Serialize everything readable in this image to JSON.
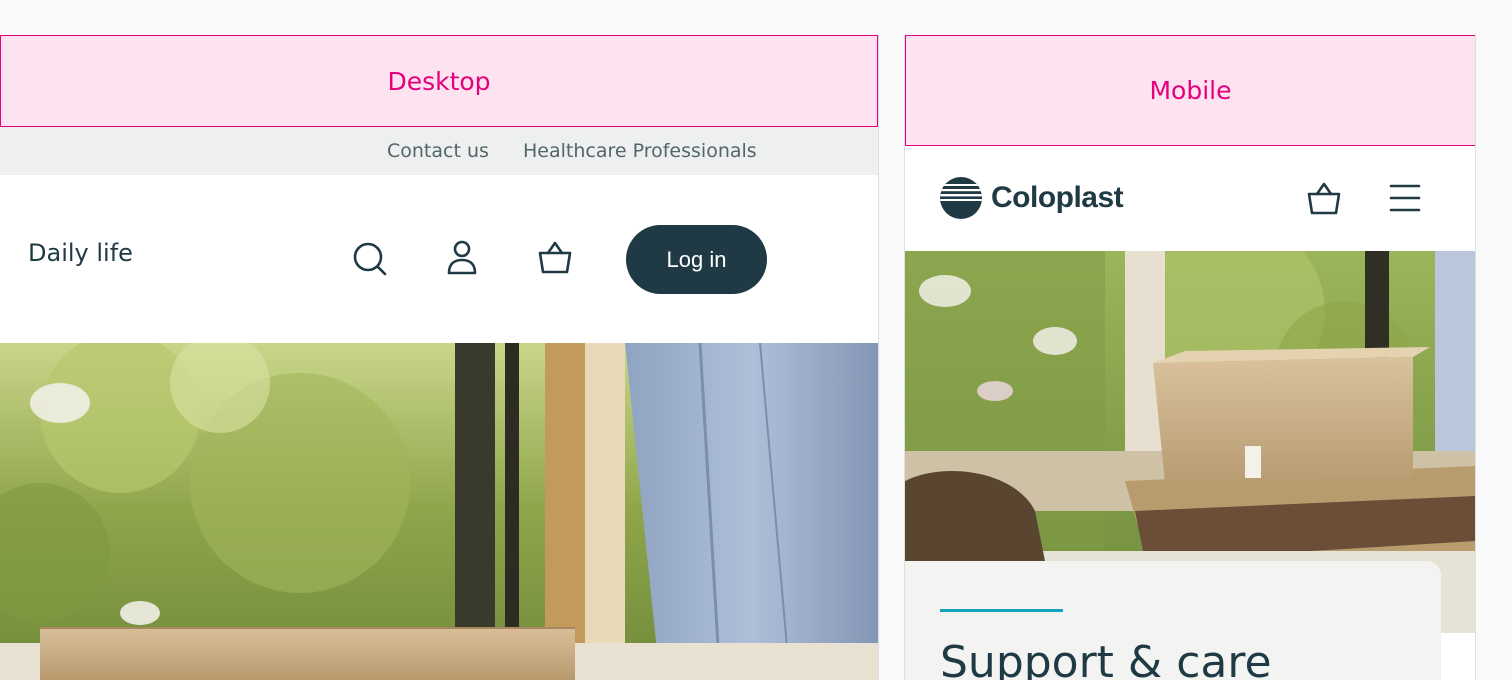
{
  "desktop": {
    "label": "Desktop",
    "utility_links": {
      "contact": "Contact us",
      "hcp": "Healthcare Professionals"
    },
    "nav": {
      "section_label": "Daily life",
      "login_label": "Log in",
      "icons": [
        "search-icon",
        "user-icon",
        "basket-icon"
      ]
    }
  },
  "mobile": {
    "label": "Mobile",
    "brand": "Coloplast",
    "icons": [
      "basket-icon",
      "hamburger-menu-icon"
    ],
    "card": {
      "title": "Support & care"
    }
  },
  "colors": {
    "label_pink": "#e5007e",
    "label_bg": "#fde2ef",
    "brand_dark": "#1f3a44",
    "utility_bg": "#eef0f0",
    "accent_teal": "#13a3be"
  }
}
